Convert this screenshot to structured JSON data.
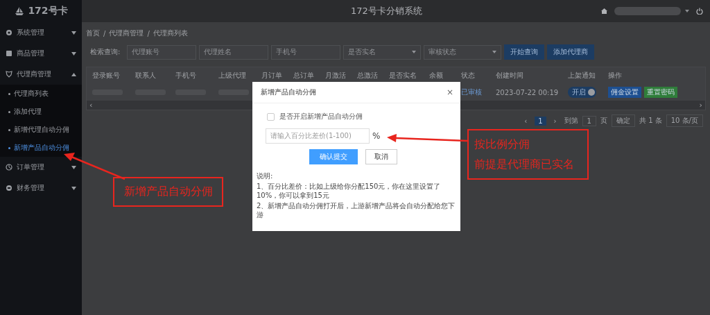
{
  "sidebar": {
    "logo": "172号卡",
    "items": [
      {
        "label": "系统管理",
        "expanded": false
      },
      {
        "label": "商品管理",
        "expanded": false
      },
      {
        "label": "代理商管理",
        "expanded": true,
        "children": [
          {
            "label": "代理商列表",
            "selected": false
          },
          {
            "label": "添加代理",
            "selected": false
          },
          {
            "label": "新增代理自动分佣",
            "selected": false
          },
          {
            "label": "新增产品自动分佣",
            "selected": true
          }
        ]
      },
      {
        "label": "订单管理",
        "expanded": false
      },
      {
        "label": "财务管理",
        "expanded": false
      }
    ]
  },
  "header": {
    "title": "172号卡分销系统"
  },
  "breadcrumb": {
    "separator": "/",
    "items": [
      "首页",
      "代理商管理",
      "代理商列表"
    ]
  },
  "search": {
    "label": "检索查询:",
    "fields": [
      {
        "kind": "input",
        "placeholder": "代理账号"
      },
      {
        "kind": "input",
        "placeholder": "代理姓名"
      },
      {
        "kind": "input",
        "placeholder": "手机号"
      },
      {
        "kind": "select",
        "placeholder": "是否实名"
      },
      {
        "kind": "select",
        "placeholder": "审核状态"
      }
    ],
    "buttons": [
      "开始查询",
      "添加代理商"
    ]
  },
  "table": {
    "columns": [
      "登录账号",
      "联系人",
      "手机号",
      "上级代理",
      "月订单",
      "总订单",
      "月激活",
      "总激活",
      "是否实名",
      "余额",
      "状态",
      "创建时间",
      "上架通知",
      "操作"
    ],
    "rows": [
      {
        "cells": [
          {
            "kind": "redacted"
          },
          {
            "kind": "redacted"
          },
          {
            "kind": "redacted"
          },
          {
            "kind": "redacted"
          },
          {
            "kind": "empty"
          },
          {
            "kind": "empty"
          },
          {
            "kind": "empty"
          },
          {
            "kind": "empty"
          },
          {
            "kind": "empty"
          },
          {
            "kind": "empty"
          },
          {
            "kind": "status",
            "text": "已审核"
          },
          {
            "kind": "text",
            "text": "2023-07-22 00:19"
          },
          {
            "kind": "toggle",
            "text": "开启",
            "on": true
          },
          {
            "kind": "actions",
            "buttons": [
              {
                "text": "佣金设置",
                "color": "#1d4f91"
              },
              {
                "text": "重置密码",
                "color": "#2f7d3a"
              }
            ]
          }
        ]
      }
    ],
    "scroll_left": "‹",
    "scroll_right": "›"
  },
  "pagination": {
    "prev": "‹",
    "pages": [
      {
        "label": "1",
        "selected": true
      }
    ],
    "next": "›",
    "goto_label": "到第",
    "goto_value": "1",
    "page_suffix": "页",
    "confirm": "确定",
    "total": "共 1 条",
    "page_size": "10 条/页"
  },
  "dialog": {
    "title": "新增产品自动分佣",
    "close": "×",
    "checkbox": {
      "label": "是否开启新增产品自动分佣",
      "checked": false
    },
    "input": {
      "placeholder": "请输入百分比差价(1-100)",
      "unit": "%"
    },
    "buttons": [
      {
        "text": "确认提交",
        "kind": "primary"
      },
      {
        "text": "取消",
        "kind": "default"
      }
    ],
    "notes": [
      "说明:",
      "1、百分比差价：比如上级给你分配150元，你在这里设置了10%，你可以拿到15元",
      "2、新增产品自动分佣打开后，上游新增产品将会自动分配给您下游"
    ]
  },
  "annotations": [
    {
      "lines": [
        "新增产品自动分佣"
      ]
    },
    {
      "lines": [
        "按比例分佣",
        "前提是代理商已实名"
      ]
    }
  ]
}
